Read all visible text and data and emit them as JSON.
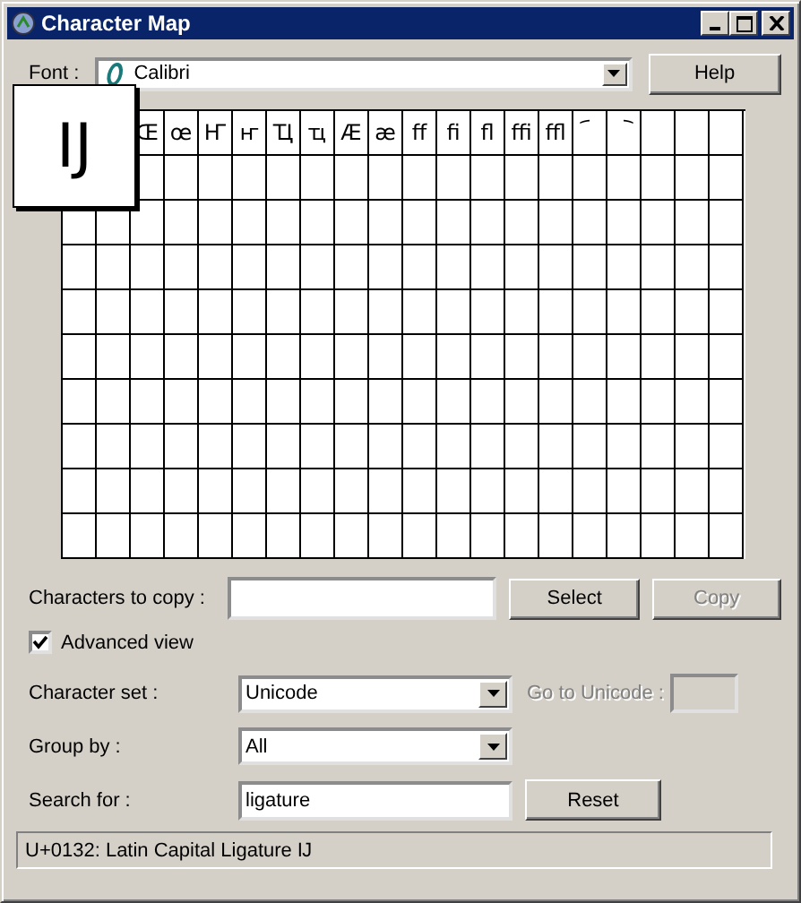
{
  "window": {
    "title": "Character Map"
  },
  "font": {
    "label": "Font :",
    "value": "Calibri"
  },
  "help_button": "Help",
  "grid": {
    "characters": [
      "Œ",
      "œ",
      "Ҥ",
      "ҥ",
      "Ҵ",
      "ҵ",
      "Ӕ",
      "ӕ",
      "ﬀ",
      "ﬁ",
      "ﬂ",
      "ﬃ",
      "ﬄ",
      "︠",
      "︡"
    ]
  },
  "magnified_character": "Ĳ",
  "characters_to_copy": {
    "label": "Characters to copy :"
  },
  "select_button": {
    "label": "Select",
    "disabled": false
  },
  "copy_button": {
    "label": "Copy",
    "disabled": true
  },
  "advanced_view": {
    "label": "Advanced view",
    "checked": true
  },
  "character_set": {
    "label": "Character set :",
    "value": "Unicode"
  },
  "go_to_unicode": {
    "label": "Go to Unicode :",
    "disabled": true
  },
  "group_by": {
    "label": "Group by :",
    "value": "All"
  },
  "search_for": {
    "label": "Search for :",
    "value": "ligature"
  },
  "reset_button": {
    "label": "Reset",
    "disabled": false
  },
  "status_bar": "U+0132: Latin Capital Ligature Ĳ"
}
